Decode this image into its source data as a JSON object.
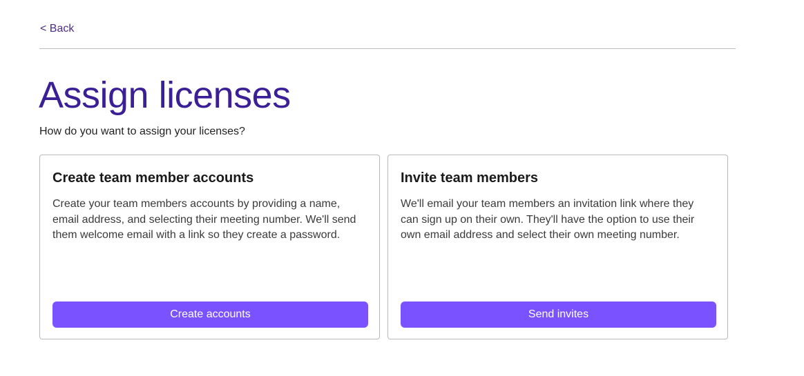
{
  "nav": {
    "back_label": "< Back"
  },
  "header": {
    "title": "Assign licenses",
    "subtitle": "How do you want to assign your licenses?"
  },
  "options": [
    {
      "title": "Create team member accounts",
      "description": "Create your team members accounts by providing a name, email address, and selecting their meeting number. We'll send them welcome email with a link so they create a password.",
      "button_label": "Create accounts"
    },
    {
      "title": "Invite team members",
      "description": "We'll email your team members an invitation link where they can sign up on their own. They'll have the option to use their own email address and select their own meeting number.",
      "button_label": "Send invites"
    }
  ],
  "colors": {
    "accent": "#7b52ff",
    "title": "#3b1f96",
    "link": "#4b2a8a"
  }
}
